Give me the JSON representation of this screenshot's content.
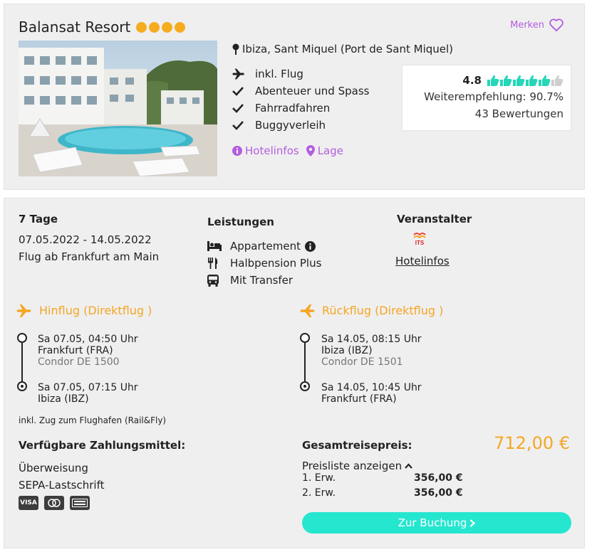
{
  "hotel": {
    "name": "Balansat Resort",
    "stars": 4,
    "merken_label": "Merken",
    "location": "Ibiza, Sant Miquel (Port de Sant Miquel)",
    "features": [
      {
        "icon": "plane-icon",
        "label": "inkl. Flug"
      },
      {
        "icon": "check-icon",
        "label": "Abenteuer und Spass"
      },
      {
        "icon": "check-icon",
        "label": "Fahrradfahren"
      },
      {
        "icon": "check-icon",
        "label": "Buggyverleih"
      }
    ],
    "links": {
      "hotelinfos": "Hotelinfos",
      "lage": "Lage"
    },
    "rating": {
      "score": "4.8",
      "thumbs": 5,
      "recommendation": "Weiterempfehlung: 90.7%",
      "reviews": "43 Bewertungen"
    }
  },
  "offer": {
    "duration": "7 Tage",
    "dates": "07.05.2022 - 14.05.2022",
    "departure": "Flug ab Frankfurt am Main",
    "leistungen_title": "Leistungen",
    "leistungen": [
      {
        "icon": "bed-icon",
        "label": "Appartement"
      },
      {
        "icon": "cutlery-icon",
        "label": "Halbpension Plus"
      },
      {
        "icon": "bus-icon",
        "label": "Mit Transfer"
      }
    ],
    "veranstalter_title": "Veranstalter",
    "veranstalter_logo_text": "ITS",
    "veranstalter_link": "Hotelinfos",
    "outbound": {
      "title": "Hinflug (Direktflug )",
      "dep_time": "Sa 07.05, 04:50 Uhr",
      "dep_airport": "Frankfurt (FRA)",
      "carrier": "Condor DE 1500",
      "arr_time": "Sa 07.05, 07:15 Uhr",
      "arr_airport": "Ibiza (IBZ)"
    },
    "inbound": {
      "title": "Rückflug (Direktflug )",
      "dep_time": "Sa 14.05, 08:15 Uhr",
      "dep_airport": "Ibiza (IBZ)",
      "carrier": "Condor DE 1501",
      "arr_time": "Sa 14.05, 10:45 Uhr",
      "arr_airport": "Frankfurt (FRA)"
    },
    "rail_note": "inkl. Zug zum Flughafen (Rail&Fly)",
    "payment": {
      "title": "Verfügbare Zahlungsmittel:",
      "methods": [
        "Überweisung",
        "SEPA-Lastschrift"
      ],
      "cards": [
        "VISA",
        "Mastercard",
        "American Express"
      ]
    },
    "price": {
      "title": "Gesamtreisepreis:",
      "total": "712,00 €",
      "list_toggle": "Preisliste anzeigen",
      "rows": [
        {
          "label": "1. Erw.",
          "amount": "356,00 €"
        },
        {
          "label": "2. Erw.",
          "amount": "356,00 €"
        }
      ]
    },
    "booking_label": "Zur Buchung",
    "colors": {
      "accent_purple": "#b45de0",
      "accent_orange": "#f5a623",
      "accent_teal": "#25e6cf"
    }
  }
}
